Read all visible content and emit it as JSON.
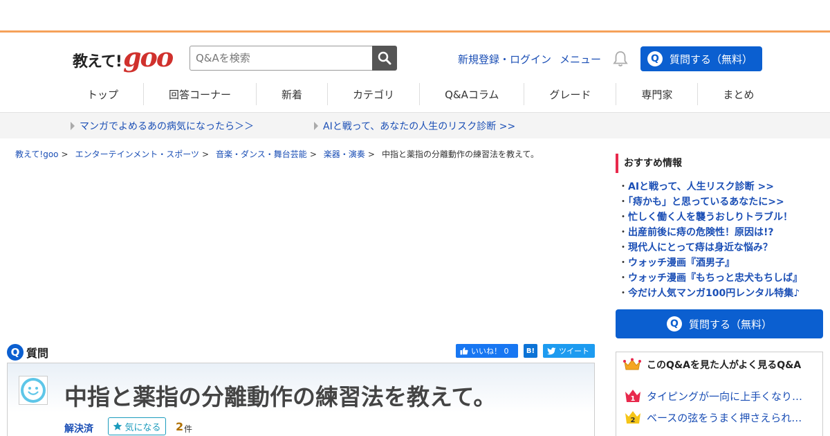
{
  "header": {
    "logo_text": "教えて!",
    "logo_goo": "goo",
    "search_placeholder": "Q&Aを検索",
    "login_link": "新規登録・ログイン",
    "menu_link": "メニュー",
    "ask_button": "質問する（無料）",
    "q_glyph": "Q"
  },
  "nav": {
    "items": [
      "トップ",
      "回答コーナー",
      "新着",
      "カテゴリ",
      "Q&Aコラム",
      "グレード",
      "専門家",
      "まとめ"
    ]
  },
  "promos": [
    "マンガでよめるあの病気になったら＞＞",
    "AIと戦って、あなたの人生のリスク診断 >>"
  ],
  "breadcrumb": {
    "items": [
      "教えて!goo",
      "エンターテインメント・スポーツ",
      "音楽・ダンス・舞台芸能",
      "楽器・演奏"
    ],
    "separator": ">",
    "current": "中指と薬指の分離動作の練習法を教えて。"
  },
  "question": {
    "heading_glyph": "Q",
    "heading": "質問",
    "title": "中指と薬指の分離動作の練習法を教えて。",
    "status": "解決済",
    "watch_label": "気になる",
    "watch_count": "2",
    "watch_unit": "件"
  },
  "share": {
    "like": "いいね！ 0",
    "hatena": "B!",
    "tweet": "ツイート"
  },
  "sidebar": {
    "recommend_title": "おすすめ情報",
    "recommend_items": [
      "AIと戦って、人生リスク診断 >>",
      "「痔かも」と思っているあなたに>>",
      "忙しく働く人を襲うおしりトラブル！",
      "出産前後に痔の危険性！原因は!?",
      "現代人にとって痔は身近な悩み？",
      "ウォッチ漫画『酒男子』",
      "ウォッチ漫画『もちっと忠犬もちしば』",
      "今だけ人気マンガ100円レンタル特集♪"
    ],
    "ask_button": "質問する（無料）",
    "related_title": "このQ&Aを見た人がよく見るQ&A",
    "related_items": [
      {
        "rank": "1",
        "text": "タイピングが一向に上手くなり…"
      },
      {
        "rank": "2",
        "text": "ベースの弦をうまく押さえられ…"
      }
    ]
  },
  "colors": {
    "brand_red": "#d0312d",
    "accent_blue": "#0b5fd0",
    "link_blue": "#1a4eb5",
    "top_strip": "#f5a15a",
    "pink_accent": "#e8294c"
  }
}
